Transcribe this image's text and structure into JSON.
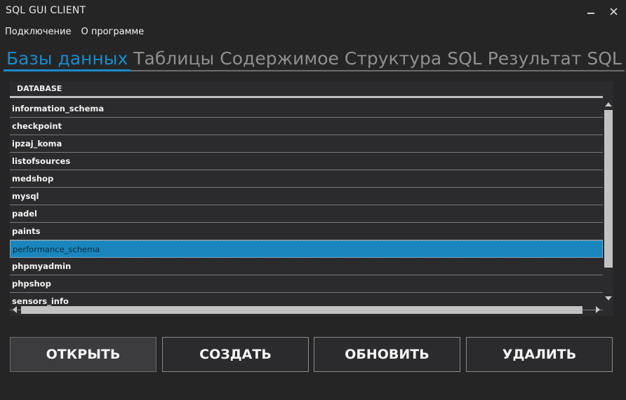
{
  "window": {
    "title": "SQL GUI CLIENT",
    "minimize_icon": "minimize-icon",
    "close_icon": "close-icon"
  },
  "menu": {
    "items": [
      {
        "label": "Подключение"
      },
      {
        "label": "О программе"
      }
    ]
  },
  "tabs": [
    {
      "label": "Базы данных",
      "active": true
    },
    {
      "label": "Таблицы",
      "active": false
    },
    {
      "label": "Содержимое",
      "active": false
    },
    {
      "label": "Структура",
      "active": false
    },
    {
      "label": "SQL",
      "active": false
    },
    {
      "label": "Результат SQL",
      "active": false
    }
  ],
  "grid": {
    "column_header": "DATABASE",
    "rows": [
      "information_schema",
      "checkpoint",
      "ipzaj_koma",
      "listofsources",
      "medshop",
      "mysql",
      "padel",
      "paints",
      "performance_schema",
      "phpmyadmin",
      "phpshop",
      "sensors_info"
    ],
    "selected_row": "performance_schema"
  },
  "buttons": {
    "open": "ОТКРЫТЬ",
    "create": "СОЗДАТЬ",
    "refresh": "ОБНОВИТЬ",
    "delete": "УДАЛИТЬ"
  },
  "colors": {
    "accent": "#1b8acb",
    "selection": "#1a86be",
    "background": "#252526"
  }
}
